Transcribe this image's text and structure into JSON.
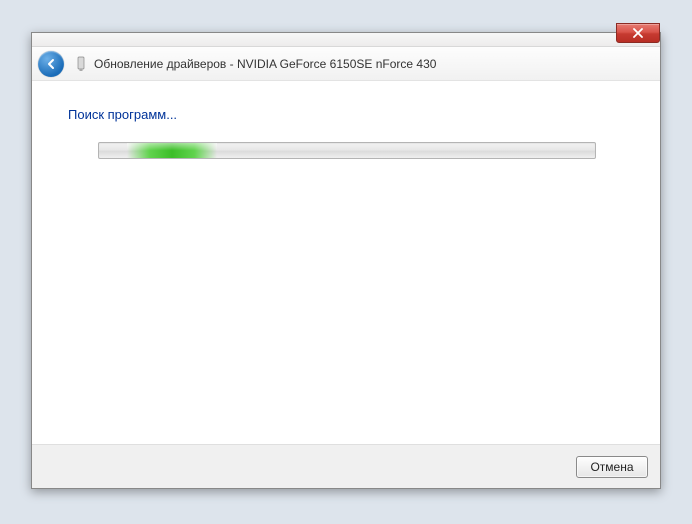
{
  "header": {
    "title": "Обновление драйверов - NVIDIA GeForce 6150SE nForce 430"
  },
  "content": {
    "status": "Поиск программ..."
  },
  "footer": {
    "cancel_label": "Отмена"
  }
}
